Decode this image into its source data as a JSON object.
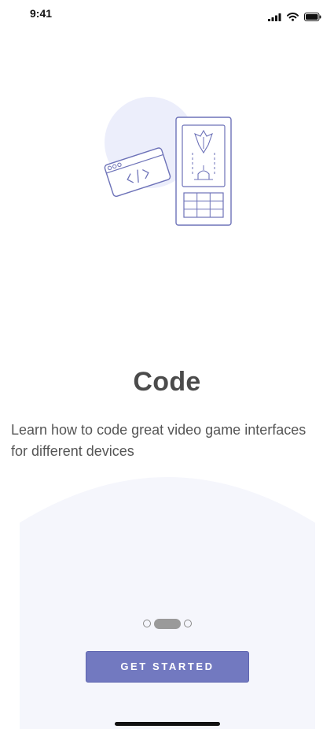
{
  "status_bar": {
    "time": "9:41",
    "icons": [
      "signal-icon",
      "wifi-icon",
      "battery-icon"
    ]
  },
  "onboarding": {
    "illustration_icons": [
      "code-window-icon",
      "game-phone-icon"
    ],
    "title": "Code",
    "description": "Learn how to code great video game interfaces for different devices",
    "pager": {
      "total_pages": 3,
      "current_page": 2
    },
    "cta_label": "GET STARTED"
  },
  "colors": {
    "accent": "#7279c0",
    "illustration_stroke": "#6d72b8",
    "illustration_blob": "#eceefb",
    "panel_background": "#f5f6fc"
  }
}
